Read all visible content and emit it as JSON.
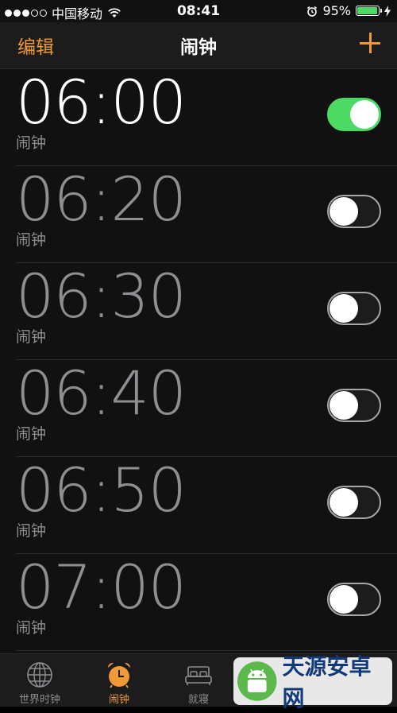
{
  "status_bar": {
    "carrier": "中国移动",
    "time": "08:41",
    "battery_percent": "95%",
    "battery_level": 0.95,
    "signal_bars": 3,
    "signal_total": 5
  },
  "nav": {
    "edit_label": "编辑",
    "title": "闹钟",
    "add_icon": "plus-icon"
  },
  "alarms": [
    {
      "time": "06:00",
      "label": "闹钟",
      "enabled": true
    },
    {
      "time": "06:20",
      "label": "闹钟",
      "enabled": false
    },
    {
      "time": "06:30",
      "label": "闹钟",
      "enabled": false
    },
    {
      "time": "06:40",
      "label": "闹钟",
      "enabled": false
    },
    {
      "time": "06:50",
      "label": "闹钟",
      "enabled": false
    },
    {
      "time": "07:00",
      "label": "闹钟",
      "enabled": false
    }
  ],
  "tabs": [
    {
      "label": "世界时钟",
      "icon": "globe-icon",
      "active": false
    },
    {
      "label": "闹钟",
      "icon": "alarm-clock-icon",
      "active": true
    },
    {
      "label": "就寝",
      "icon": "bed-icon",
      "active": false
    }
  ],
  "watermark": {
    "text": "天源安卓网"
  },
  "colors": {
    "accent": "#f09a37",
    "toggle_on": "#4cd964",
    "background": "#111112"
  }
}
